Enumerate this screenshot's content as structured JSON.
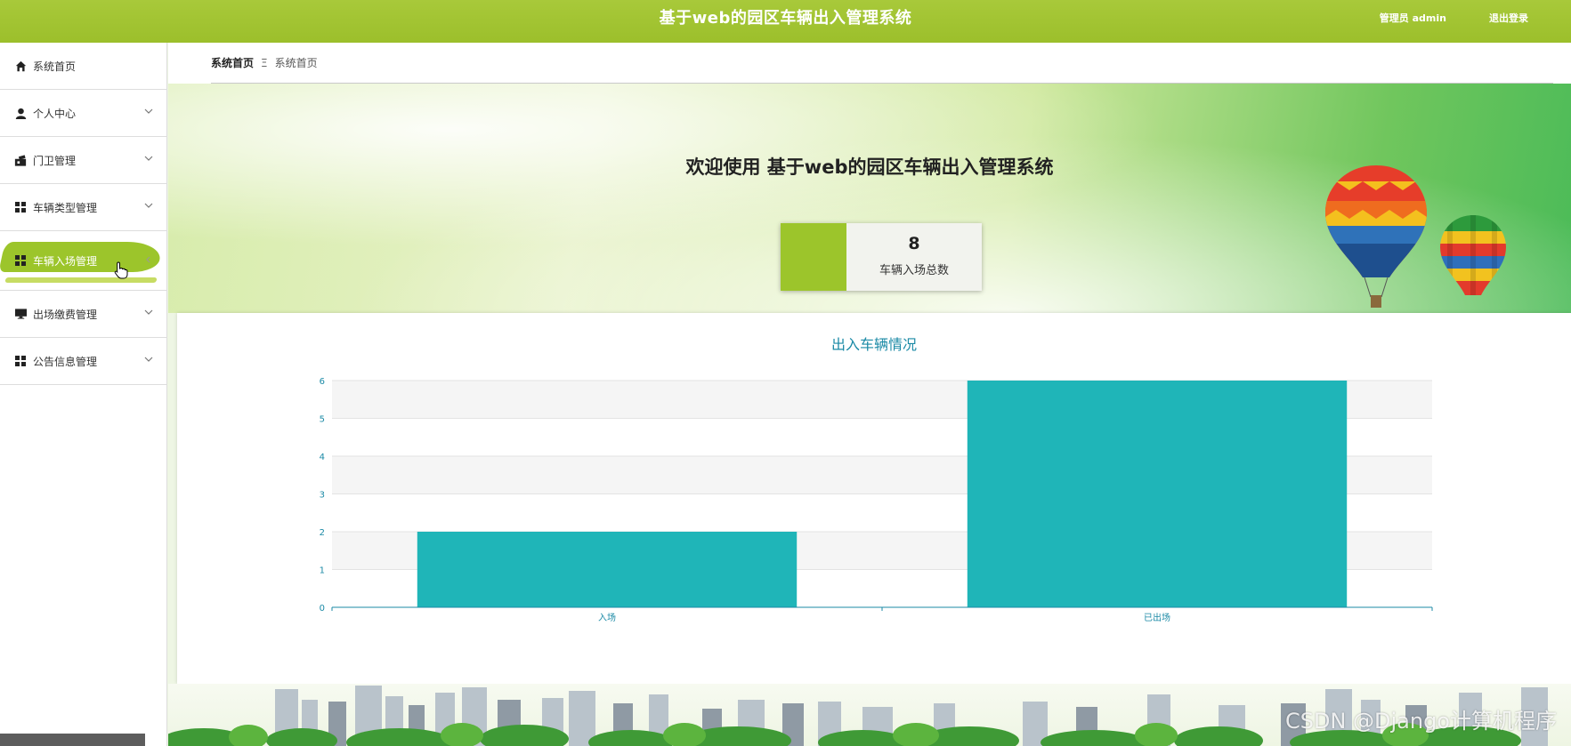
{
  "header": {
    "title": "基于web的园区车辆出入管理系统",
    "user": "管理员 admin",
    "logout": "退出登录"
  },
  "sidebar": {
    "items": [
      {
        "label": "系统首页",
        "icon": "home-icon",
        "has_children": false
      },
      {
        "label": "个人中心",
        "icon": "user-icon",
        "has_children": true
      },
      {
        "label": "门卫管理",
        "icon": "gate-icon",
        "has_children": true
      },
      {
        "label": "车辆类型管理",
        "icon": "grid-icon",
        "has_children": true
      },
      {
        "label": "车辆入场管理",
        "icon": "grid-icon",
        "has_children": true,
        "active": true
      },
      {
        "label": "出场缴费管理",
        "icon": "monitor-icon",
        "has_children": true
      },
      {
        "label": "公告信息管理",
        "icon": "grid-icon",
        "has_children": true
      }
    ]
  },
  "breadcrumb": {
    "home": "系统首页",
    "separator": "Ξ",
    "current": "系统首页"
  },
  "hero": {
    "welcome": "欢迎使用 基于web的园区车辆出入管理系统",
    "stat": {
      "value": "8",
      "label": "车辆入场总数"
    }
  },
  "chart_data": {
    "type": "bar",
    "title": "出入车辆情况",
    "categories": [
      "入场",
      "已出场"
    ],
    "values": [
      2,
      6
    ],
    "ylim": [
      0,
      6
    ],
    "yticks": [
      0,
      1,
      2,
      3,
      4,
      5,
      6
    ],
    "grid": true,
    "colors": {
      "bar": "#1fb5b8",
      "axis": "#1b8aa6"
    }
  },
  "watermark": "CSDN @Django计算机程序",
  "colors": {
    "accent": "#9cc52b",
    "topbar": "#a3c533"
  }
}
